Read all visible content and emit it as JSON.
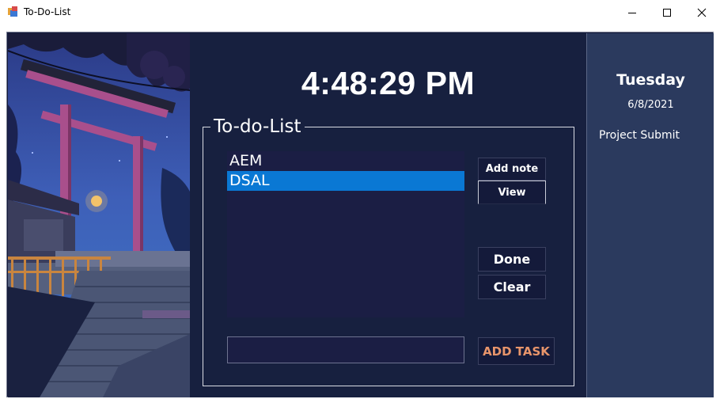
{
  "window": {
    "title": "To-Do-List",
    "icon": "app-icon",
    "controls": [
      "minimize",
      "maximize",
      "close"
    ]
  },
  "clock": {
    "time": "4:48:29 PM"
  },
  "todo": {
    "group_title": "To-do-List",
    "items": [
      {
        "label": "AEM",
        "selected": false
      },
      {
        "label": "DSAL",
        "selected": true
      }
    ],
    "buttons": {
      "add_note": "Add note",
      "view": "View",
      "done": "Done",
      "clear": "Clear",
      "add_task": "ADD TASK"
    },
    "task_input": {
      "value": "",
      "placeholder": ""
    }
  },
  "sidebar": {
    "day": "Tuesday",
    "date": "6/8/2021",
    "note": "Project Submit"
  },
  "colors": {
    "main_background": "#17203f",
    "sidebar_background": "#2b3a5e",
    "selection": "#0a78d4",
    "add_task_text": "#e8956b"
  }
}
